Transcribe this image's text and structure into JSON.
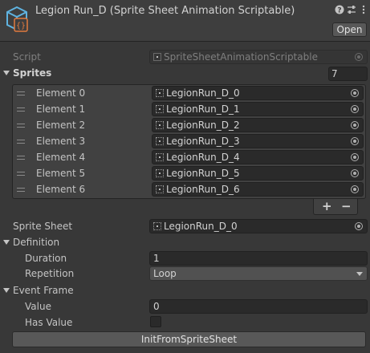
{
  "header": {
    "title": "Legion Run_D (Sprite Sheet Animation Scriptable)",
    "open_label": "Open",
    "icons": [
      "help-icon",
      "preset-icon",
      "kebab-menu-icon"
    ]
  },
  "script": {
    "label": "Script",
    "value": "SpriteSheetAnimationScriptable"
  },
  "sprites": {
    "label": "Sprites",
    "count": "7",
    "elements": [
      {
        "label": "Element 0",
        "value": "LegionRun_D_0"
      },
      {
        "label": "Element 1",
        "value": "LegionRun_D_1"
      },
      {
        "label": "Element 2",
        "value": "LegionRun_D_2"
      },
      {
        "label": "Element 3",
        "value": "LegionRun_D_3"
      },
      {
        "label": "Element 4",
        "value": "LegionRun_D_4"
      },
      {
        "label": "Element 5",
        "value": "LegionRun_D_5"
      },
      {
        "label": "Element 6",
        "value": "LegionRun_D_6"
      }
    ],
    "add_label": "+",
    "remove_label": "−"
  },
  "sprite_sheet": {
    "label": "Sprite Sheet",
    "value": "LegionRun_D_0"
  },
  "definition": {
    "label": "Definition",
    "duration_label": "Duration",
    "duration_value": "1",
    "repetition_label": "Repetition",
    "repetition_value": "Loop"
  },
  "event_frame": {
    "label": "Event Frame",
    "value_label": "Value",
    "value": "0",
    "has_value_label": "Has Value",
    "has_value_checked": false
  },
  "init_button_label": "InitFromSpriteSheet",
  "colors": {
    "background": "#383838",
    "header": "#3e3e3e",
    "field": "#2a2a2a",
    "button": "#585858",
    "asset_icon": "#5fb3e0",
    "script_icon_accent": "#e07a3f"
  }
}
